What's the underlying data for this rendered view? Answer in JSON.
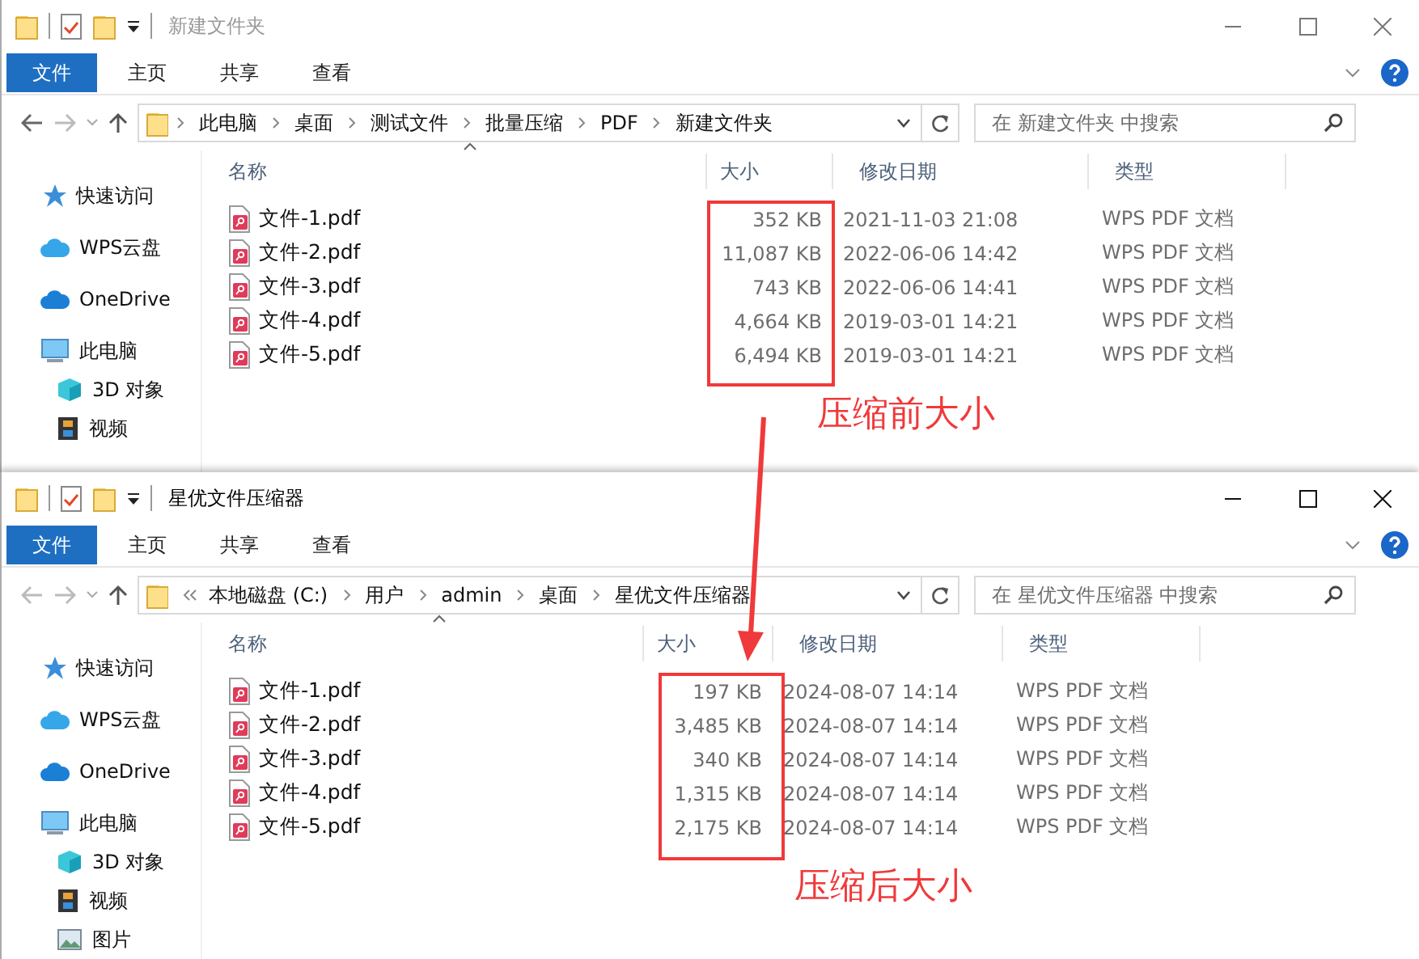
{
  "windows": [
    {
      "title": "新建文件夹",
      "active": false,
      "ribbon_tabs": [
        {
          "label": "文件",
          "kind": "file"
        },
        {
          "label": "主页",
          "kind": "tab"
        },
        {
          "label": "共享",
          "kind": "tab"
        },
        {
          "label": "查看",
          "kind": "tab"
        }
      ],
      "address": {
        "overflow": false,
        "crumbs": [
          "此电脑",
          "桌面",
          "测试文件",
          "批量压缩",
          "PDF",
          "新建文件夹"
        ]
      },
      "search": {
        "placeholder": "在 新建文件夹 中搜索"
      },
      "sidebar": [
        {
          "label": "快速访问"
        },
        {
          "label": "WPS云盘"
        },
        {
          "label": "OneDrive"
        },
        {
          "label": "此电脑",
          "children": [
            {
              "label": "3D 对象"
            },
            {
              "label": "视频"
            }
          ]
        }
      ],
      "columns": [
        "名称",
        "大小",
        "修改日期",
        "类型"
      ],
      "files": [
        {
          "name": "文件-1.pdf",
          "size": "352 KB",
          "modified": "2021-11-03 21:08",
          "type": "WPS PDF 文档"
        },
        {
          "name": "文件-2.pdf",
          "size": "11,087 KB",
          "modified": "2022-06-06 14:42",
          "type": "WPS PDF 文档"
        },
        {
          "name": "文件-3.pdf",
          "size": "743 KB",
          "modified": "2022-06-06 14:41",
          "type": "WPS PDF 文档"
        },
        {
          "name": "文件-4.pdf",
          "size": "4,664 KB",
          "modified": "2019-03-01 14:21",
          "type": "WPS PDF 文档"
        },
        {
          "name": "文件-5.pdf",
          "size": "6,494 KB",
          "modified": "2019-03-01 14:21",
          "type": "WPS PDF 文档"
        }
      ]
    },
    {
      "title": "星优文件压缩器",
      "active": true,
      "ribbon_tabs": [
        {
          "label": "文件",
          "kind": "file"
        },
        {
          "label": "主页",
          "kind": "tab"
        },
        {
          "label": "共享",
          "kind": "tab"
        },
        {
          "label": "查看",
          "kind": "tab"
        }
      ],
      "address": {
        "overflow": true,
        "crumbs": [
          "本地磁盘 (C:)",
          "用户",
          "admin",
          "桌面",
          "星优文件压缩器"
        ]
      },
      "search": {
        "placeholder": "在 星优文件压缩器 中搜索"
      },
      "sidebar": [
        {
          "label": "快速访问"
        },
        {
          "label": "WPS云盘"
        },
        {
          "label": "OneDrive"
        },
        {
          "label": "此电脑",
          "children": [
            {
              "label": "3D 对象"
            },
            {
              "label": "视频"
            },
            {
              "label": "图片"
            }
          ]
        }
      ],
      "columns": [
        "名称",
        "大小",
        "修改日期",
        "类型"
      ],
      "files": [
        {
          "name": "文件-1.pdf",
          "size": "197 KB",
          "modified": "2024-08-07 14:14",
          "type": "WPS PDF 文档"
        },
        {
          "name": "文件-2.pdf",
          "size": "3,485 KB",
          "modified": "2024-08-07 14:14",
          "type": "WPS PDF 文档"
        },
        {
          "name": "文件-3.pdf",
          "size": "340 KB",
          "modified": "2024-08-07 14:14",
          "type": "WPS PDF 文档"
        },
        {
          "name": "文件-4.pdf",
          "size": "1,315 KB",
          "modified": "2024-08-07 14:14",
          "type": "WPS PDF 文档"
        },
        {
          "name": "文件-5.pdf",
          "size": "2,175 KB",
          "modified": "2024-08-07 14:14",
          "type": "WPS PDF 文档"
        }
      ]
    }
  ],
  "annotations": [
    {
      "text": "压缩前大小"
    },
    {
      "text": "压缩后大小"
    }
  ]
}
